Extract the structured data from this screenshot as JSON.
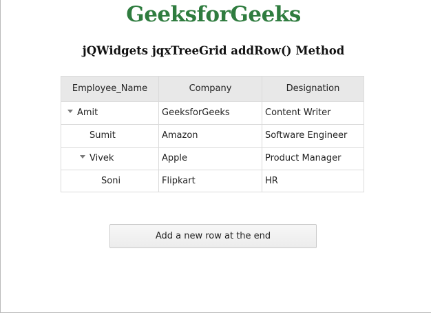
{
  "header": {
    "brand": "GeeksforGeeks",
    "subtitle": "jQWidgets jqxTreeGrid addRow() Method"
  },
  "grid": {
    "columns": [
      "Employee_Name",
      "Company",
      "Designation"
    ],
    "rows": [
      {
        "name": "Amit",
        "company": "GeeksforGeeks",
        "designation": "Content Writer",
        "level": 0,
        "expanded": true
      },
      {
        "name": "Sumit",
        "company": "Amazon",
        "designation": "Software Engineer",
        "level": 1,
        "expanded": false
      },
      {
        "name": "Vivek",
        "company": "Apple",
        "designation": "Product Manager",
        "level": 1,
        "expanded": true
      },
      {
        "name": "Soni",
        "company": "Flipkart",
        "designation": "HR",
        "level": 2,
        "expanded": false
      }
    ]
  },
  "actions": {
    "add_row_label": "Add a new row at the end"
  },
  "colors": {
    "brand": "#2f7c3f",
    "header_bg": "#e8e8e8",
    "border": "#dadada"
  },
  "icons": {
    "expander": "caret-down-icon"
  }
}
